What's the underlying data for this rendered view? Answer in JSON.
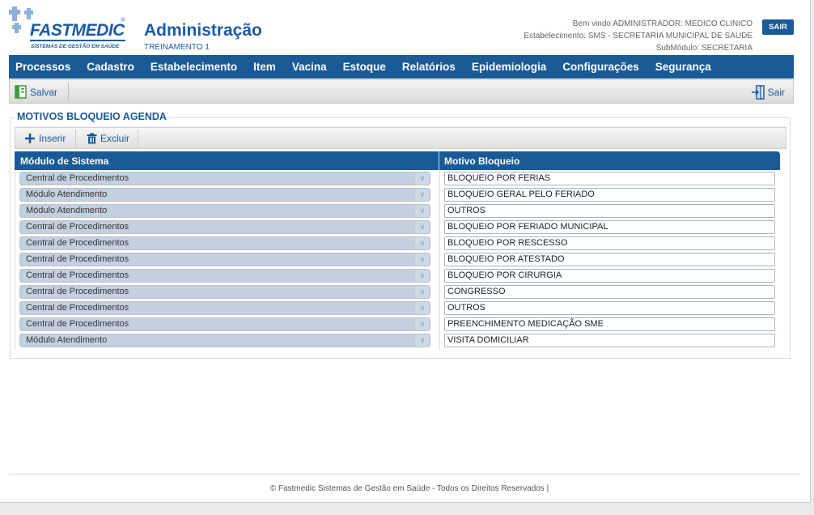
{
  "brand": {
    "name": "FASTMEDIC",
    "registered": "®",
    "tagline": "SISTEMAS DE GESTÃO EM SAÚDE"
  },
  "header": {
    "title": "Administração",
    "subtitle": "TREINAMENTO 1",
    "welcome": "Bem vindo ADMINISTRADOR: MEDICO CLINICO",
    "establishment": "Estabelecimento: SMS - SECRETARIA MUNICIPAL DE SAUDE",
    "submodule": "SubMódulo: SECRETARIA",
    "exit_label": "SAIR"
  },
  "menu": [
    "Processos",
    "Cadastro",
    "Estabelecimento",
    "Item",
    "Vacina",
    "Estoque",
    "Relatórios",
    "Epidemiologia",
    "Configurações",
    "Segurança"
  ],
  "toolbar": {
    "save_label": "Salvar",
    "exit_label": "Sair"
  },
  "panel": {
    "title": "MOTIVOS BLOQUEIO AGENDA",
    "insert_label": "Inserir",
    "delete_label": "Excluir"
  },
  "grid": {
    "columns": [
      "Módulo de Sistema",
      "Motivo Bloqueio"
    ],
    "rows": [
      {
        "module": "Central de Procedimentos",
        "reason": "BLOQUEIO POR FERIAS"
      },
      {
        "module": "Módulo Atendimento",
        "reason": "BLOQUEIO GERAL PELO FERIADO"
      },
      {
        "module": "Módulo Atendimento",
        "reason": "OUTROS"
      },
      {
        "module": "Central de Procedimentos",
        "reason": "BLOQUEIO POR FERIADO MUNICIPAL"
      },
      {
        "module": "Central de Procedimentos",
        "reason": "BLOQUEIO POR RESCESSO"
      },
      {
        "module": "Central de Procedimentos",
        "reason": "BLOQUEIO POR ATESTADO"
      },
      {
        "module": "Central de Procedimentos",
        "reason": "BLOQUEIO POR CIRURGIA"
      },
      {
        "module": "Central de Procedimentos",
        "reason": "CONGRESSO"
      },
      {
        "module": "Central de Procedimentos",
        "reason": "OUTROS"
      },
      {
        "module": "Central de Procedimentos",
        "reason": "PREENCHIMENTO MEDICAÇÃO SME"
      },
      {
        "module": "Módulo Atendimento",
        "reason": "VISITA DOMICILIAR"
      }
    ]
  },
  "footer": {
    "text": "© Fastmedic Sistemas de Gestão em Saúde - Todos os Direitos Reservados |"
  },
  "colors": {
    "primary": "#1a5a96",
    "brand_blue": "#1a5aa6",
    "select_bg": "#c3d1de"
  },
  "icons": {
    "save": "save-document-icon",
    "exit": "exit-door-icon",
    "insert": "plus-icon",
    "delete": "trash-icon",
    "dropdown": "chevron-down-icon"
  }
}
